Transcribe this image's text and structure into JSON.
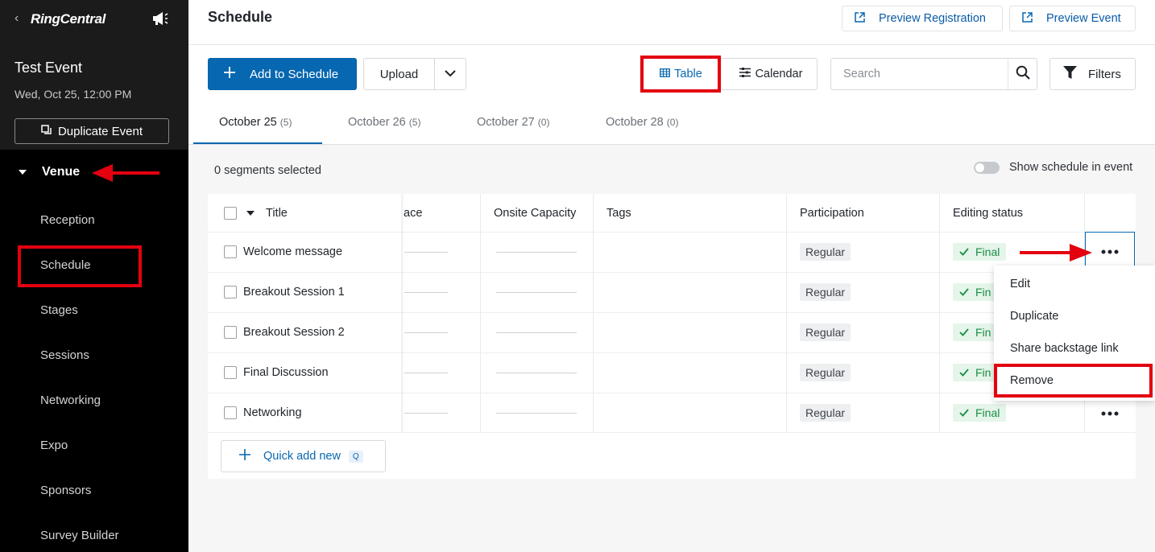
{
  "sidebar": {
    "back_glyph": "‹",
    "logo": "RingCentral",
    "event_title": "Test Event",
    "event_date": "Wed, Oct 25, 12:00 PM",
    "duplicate_label": "Duplicate Event",
    "section_label": "Venue",
    "items": [
      "Reception",
      "Schedule",
      "Stages",
      "Sessions",
      "Networking",
      "Expo",
      "Sponsors",
      "Survey Builder"
    ]
  },
  "header": {
    "title": "Schedule",
    "preview_registration": "Preview Registration",
    "preview_event": "Preview Event"
  },
  "toolbar": {
    "add_label": "Add to Schedule",
    "upload_label": "Upload",
    "table_label": "Table",
    "calendar_label": "Calendar",
    "search_placeholder": "Search",
    "filters_label": "Filters"
  },
  "tabs": [
    {
      "label": "October 25",
      "count": "(5)"
    },
    {
      "label": "October 26",
      "count": "(5)"
    },
    {
      "label": "October 27",
      "count": "(0)"
    },
    {
      "label": "October 28",
      "count": "(0)"
    }
  ],
  "selection": {
    "count_label": "0 segments selected",
    "toggle_label": "Show schedule in event"
  },
  "table": {
    "columns": {
      "title": "Title",
      "space": "ace",
      "capacity": "Onsite Capacity",
      "tags": "Tags",
      "participation": "Participation",
      "status": "Editing status"
    },
    "rows": [
      {
        "title": "Welcome message",
        "participation": "Regular",
        "status": "Final"
      },
      {
        "title": "Breakout Session 1",
        "participation": "Regular",
        "status": "Fin"
      },
      {
        "title": "Breakout Session 2",
        "participation": "Regular",
        "status": "Fin"
      },
      {
        "title": "Final Discussion",
        "participation": "Regular",
        "status": "Fin"
      },
      {
        "title": "Networking",
        "participation": "Regular",
        "status": "Final"
      }
    ],
    "quick_add_label": "Quick add new",
    "quick_add_key": "Q"
  },
  "context_menu": {
    "items": [
      "Edit",
      "Duplicate",
      "Share backstage link",
      "Remove"
    ]
  },
  "colors": {
    "primary": "#0767b0",
    "annotation_red": "#e3000f",
    "final_green": "#1a8d45"
  }
}
